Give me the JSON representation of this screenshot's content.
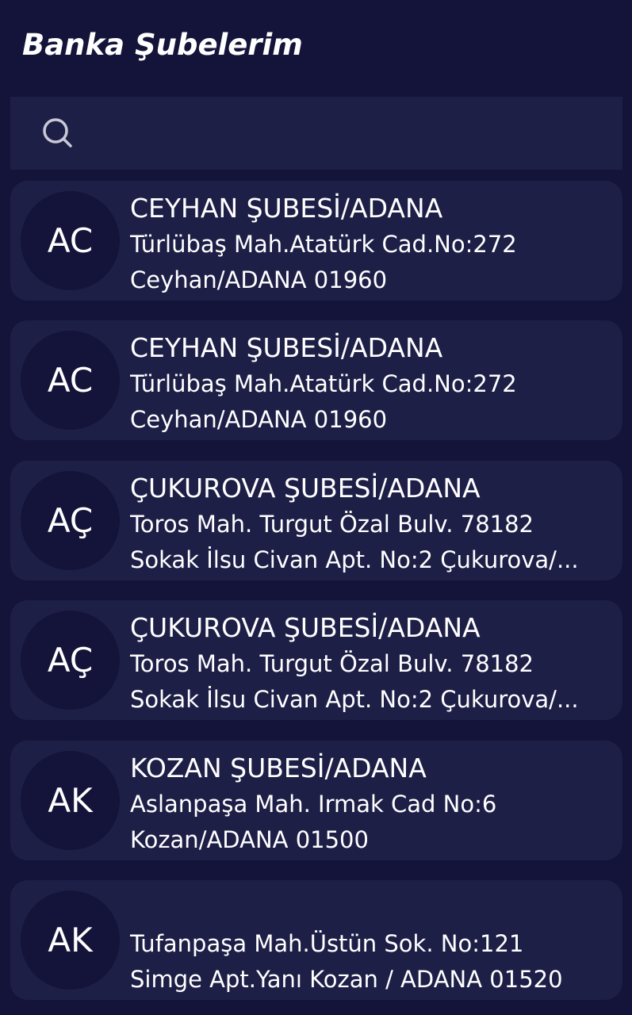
{
  "header": {
    "title": "Banka Şubelerim"
  },
  "search": {
    "placeholder": "",
    "value": ""
  },
  "branches": [
    {
      "initials": "AC",
      "name": "CEYHAN ŞUBESİ/ADANA",
      "address_line1": "Türlübaş Mah.Atatürk Cad.No:272",
      "address_line2": "Ceyhan/ADANA 01960"
    },
    {
      "initials": "AC",
      "name": "CEYHAN ŞUBESİ/ADANA",
      "address_line1": "Türlübaş Mah.Atatürk Cad.No:272",
      "address_line2": "Ceyhan/ADANA 01960"
    },
    {
      "initials": "AÇ",
      "name": "ÇUKUROVA ŞUBESİ/ADANA",
      "address_line1": "Toros Mah. Turgut Özal Bulv. 78182",
      "address_line2": "Sokak İlsu Civan Apt. No:2 Çukurova/..."
    },
    {
      "initials": "AÇ",
      "name": "ÇUKUROVA ŞUBESİ/ADANA",
      "address_line1": "Toros Mah. Turgut Özal Bulv. 78182",
      "address_line2": "Sokak İlsu Civan Apt. No:2 Çukurova/..."
    },
    {
      "initials": "AK",
      "name": "KOZAN ŞUBESİ/ADANA",
      "address_line1": "Aslanpaşa Mah. Irmak Cad No:6",
      "address_line2": "Kozan/ADANA 01500"
    },
    {
      "initials": "AK",
      "name": "",
      "address_line1": "Tufanpaşa Mah.Üstün Sok. No:121",
      "address_line2": "Simge Apt.Yanı Kozan / ADANA 01520"
    }
  ],
  "colors": {
    "background": "#14143a",
    "card": "#1e1f47",
    "text": "#ffffff",
    "icon": "#c9c9d6"
  },
  "icons": {
    "search": "search-icon"
  }
}
